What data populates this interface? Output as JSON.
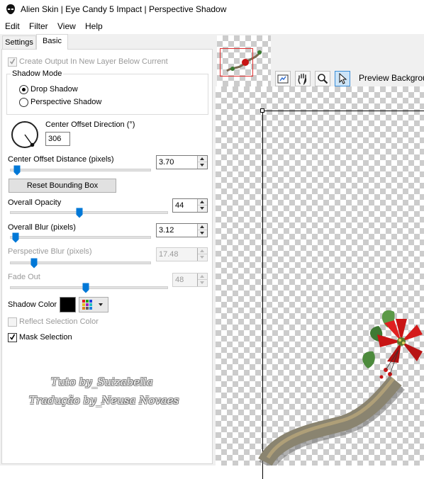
{
  "window": {
    "title": "Alien Skin | Eye Candy 5 Impact | Perspective Shadow"
  },
  "menu": {
    "items": [
      "Edit",
      "Filter",
      "View",
      "Help"
    ]
  },
  "tabs": {
    "settings": "Settings",
    "basic": "Basic",
    "active": "Basic"
  },
  "basic": {
    "create_output_label": "Create Output In New Layer Below Current",
    "create_output_checked": true,
    "shadow_mode": {
      "title": "Shadow Mode",
      "options": [
        "Drop Shadow",
        "Perspective Shadow"
      ],
      "selected": "Drop Shadow"
    },
    "center_offset_direction": {
      "label": "Center Offset Direction (°)",
      "value": "306"
    },
    "center_offset_distance": {
      "label": "Center Offset Distance (pixels)",
      "value": "3.70",
      "slider_fraction": 0.05
    },
    "reset_bounding_box_label": "Reset Bounding Box",
    "overall_opacity": {
      "label": "Overall Opacity",
      "value": "44",
      "slider_fraction": 0.44
    },
    "overall_blur": {
      "label": "Overall Blur (pixels)",
      "value": "3.12",
      "slider_fraction": 0.04
    },
    "perspective_blur": {
      "label": "Perspective Blur (pixels)",
      "value": "17.48",
      "slider_fraction": 0.17,
      "enabled": false
    },
    "fade_out": {
      "label": "Fade Out",
      "value": "48",
      "slider_fraction": 0.48,
      "enabled": false
    },
    "shadow_color": {
      "label": "Shadow Color",
      "value": "#000000"
    },
    "reflect_selection_color": {
      "label": "Reflect Selection Color",
      "checked": false,
      "enabled": false
    },
    "mask_selection": {
      "label": "Mask Selection",
      "checked": true
    }
  },
  "watermark": {
    "line1": "Tuto by_Suizabella",
    "line2": "Tradução by_Neusa Novaes"
  },
  "preview": {
    "background_label": "Preview Backgroun",
    "tools": [
      "preview-toggle-icon",
      "hand-icon",
      "zoom-icon",
      "pointer-icon"
    ],
    "active_tool": "pointer-icon"
  },
  "colors": {
    "accent": "#0078d7",
    "poinsettia_red": "#c81414",
    "leaf_green": "#4c8a3c",
    "ribbon_gold": "#9c8250"
  }
}
